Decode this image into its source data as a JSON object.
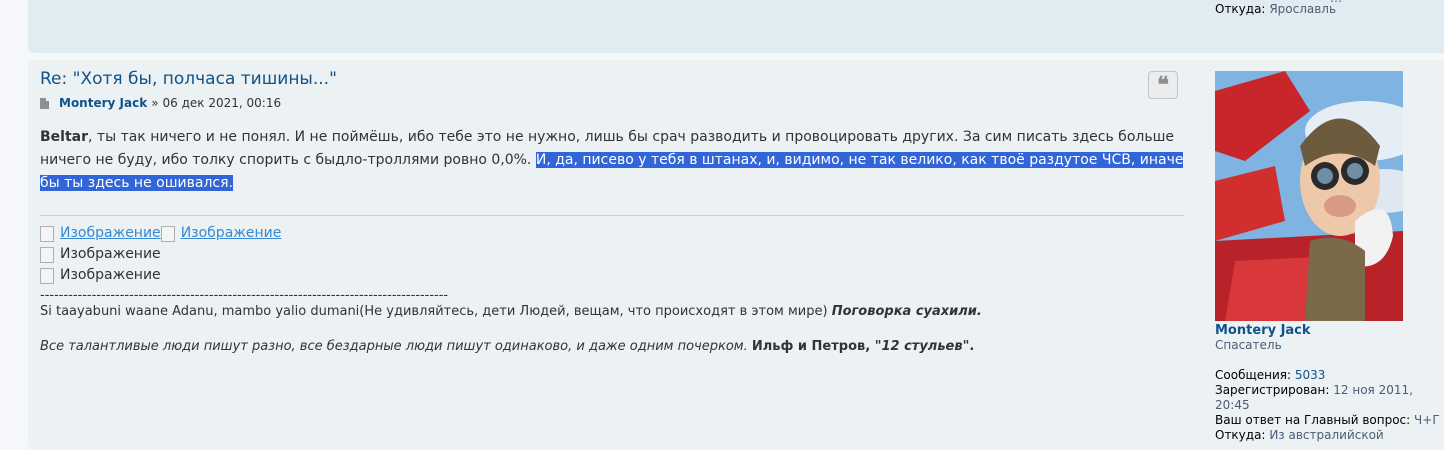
{
  "previous_post": {
    "cut_text": "…",
    "from_label": "Откуда:",
    "from_value": "Ярославль"
  },
  "post": {
    "title": "Re: \"Хотя бы, полчаса тишины...\"",
    "author": "Montery Jack",
    "meta_separator": "»",
    "date": "06 дек 2021, 00:16",
    "body": {
      "mention": "Beltar",
      "text": ", ты так ничего и не понял. И не поймёшь, ибо тебе это не нужно, лишь бы срач разводить и провоцировать других. За сим писать здесь больше ничего не буду, ибо толку спорить с быдло-троллями ровно 0,0%. ",
      "highlighted": "И, да, писево у тебя в штанах, и, видимо, не так велико, как твоё раздутое ЧСВ, иначе бы ты здесь не ошивался."
    },
    "signature": {
      "images": [
        [
          "Изображение",
          "Изображение"
        ],
        [
          "Изображение"
        ],
        [
          "Изображение"
        ]
      ],
      "dashes": "---------------------------------------------------------------------------------------",
      "line1_text": "Si taayabuni waane Adanu, mambo yalio dumani(Не удивляйтесь, дети Людей, вещам, что происходят в этом мире) ",
      "line1_bold": "Поговорка суахили.",
      "line2_text": "Все талантливые люди пишут разно, все бездарные люди пишут одинаково, и даже одним почерком. ",
      "line2_bold_a": "Ильф и Петров, ",
      "line2_bold_b": "\"12 стульев\"",
      "line2_bold_c": "."
    }
  },
  "profile": {
    "username": "Montery Jack",
    "rank": "Спасатель",
    "posts_label": "Сообщения:",
    "posts_value": "5033",
    "registered_label": "Зарегистрирован:",
    "registered_value_1": "12 ноя 2011,",
    "registered_value_2": "20:45",
    "question_label": "Ваш ответ на Главный вопрос:",
    "question_value": "Ч+Г",
    "from_label": "Откуда:",
    "from_value": "Из австралийской"
  },
  "colors": {
    "link": "#105289",
    "post_bg": "#ecf1f3",
    "prev_post_bg": "#e1ebf2",
    "selection": "#3165d8"
  }
}
